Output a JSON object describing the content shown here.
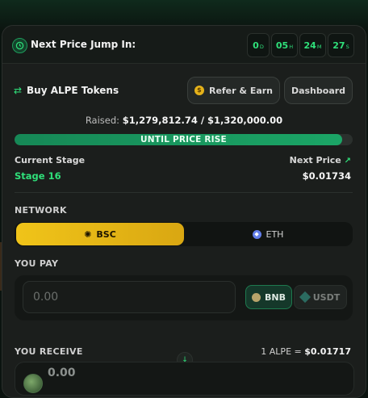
{
  "header": {
    "title": "Next Price Jump In:",
    "timer": [
      {
        "value": "0",
        "unit": "D"
      },
      {
        "value": "05",
        "unit": "H"
      },
      {
        "value": "24",
        "unit": "M"
      },
      {
        "value": "27",
        "unit": "S"
      }
    ]
  },
  "buy": {
    "title": "Buy ALPE Tokens",
    "refer_label": "Refer & Earn",
    "dashboard_label": "Dashboard"
  },
  "raised": {
    "label": "Raised:",
    "amount": "$1,279,812.74 / $1,320,000.00",
    "progress_percent": 96.9,
    "bar_label": "UNTIL PRICE RISE"
  },
  "stage": {
    "current_label": "Current Stage",
    "current_value": "Stage 16",
    "next_label": "Next Price",
    "next_value": "$0.01734"
  },
  "network": {
    "label": "NETWORK",
    "options": [
      "BSC",
      "ETH"
    ],
    "selected": "BSC"
  },
  "pay": {
    "label": "YOU PAY",
    "placeholder": "0.00",
    "currencies": [
      "BNB",
      "USDT"
    ],
    "selected_currency": "BNB"
  },
  "receive": {
    "label": "YOU RECEIVE",
    "rate_prefix": "1 ALPE =",
    "rate_value": "$0.01717",
    "amount": "0.00"
  },
  "colors": {
    "accent": "#2fe07a",
    "bsc": "#f0c419",
    "progress": "#1ba566"
  }
}
